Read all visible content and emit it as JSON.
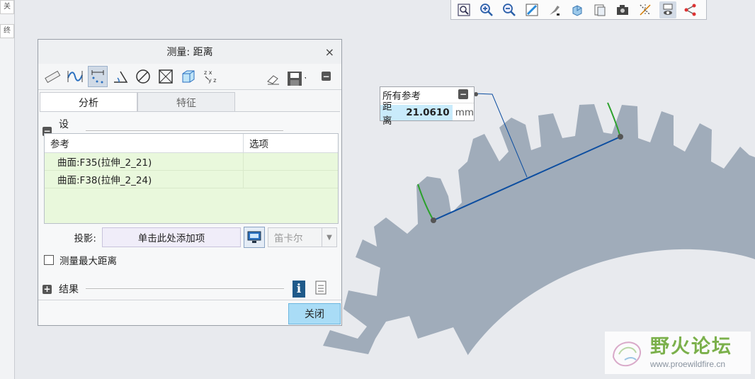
{
  "left_strip": {
    "tab1": "关",
    "tab2": "终"
  },
  "toolbar": {
    "icons": [
      "zoom-window-icon",
      "zoom-in-icon",
      "zoom-out-icon",
      "refit-icon",
      "repaint-icon",
      "view-orient-icon",
      "saved-views-icon",
      "camera-icon",
      "datum-display-icon",
      "spin-center-icon",
      "annotation-display-icon"
    ]
  },
  "dialog": {
    "title": "测量: 距离",
    "close_glyph": "×",
    "tabs": {
      "analysis": "分析",
      "feature": "特征"
    },
    "settings": {
      "label": "设置",
      "toggle": "−",
      "table": {
        "col_ref": "参考",
        "col_opt": "选项",
        "rows": [
          {
            "ref": "曲面:F35(拉伸_2_21)",
            "opt": ""
          },
          {
            "ref": "曲面:F38(拉伸_2_24)",
            "opt": ""
          }
        ]
      },
      "projection": {
        "label": "投影:",
        "placeholder": "单击此处添加项",
        "coord_select": "笛卡尔"
      },
      "max_distance": {
        "label": "测量最大距离",
        "checked": false
      }
    },
    "results": {
      "label": "结果",
      "toggle": "+"
    },
    "close_button": "关闭"
  },
  "callout": {
    "title": "所有参考",
    "toggle": "−",
    "distance_label": "距离",
    "distance_value": "21.0610",
    "unit": "mm"
  },
  "watermark": {
    "title": "野火论坛",
    "url": "www.proewildfire.cn"
  },
  "colors": {
    "gear": "#a0acba",
    "measure_line": "#0d4ea0",
    "highlight_edge": "#2ca12c",
    "callout_value_bg": "#c9ebfb",
    "close_button": "#a9dcf6"
  }
}
